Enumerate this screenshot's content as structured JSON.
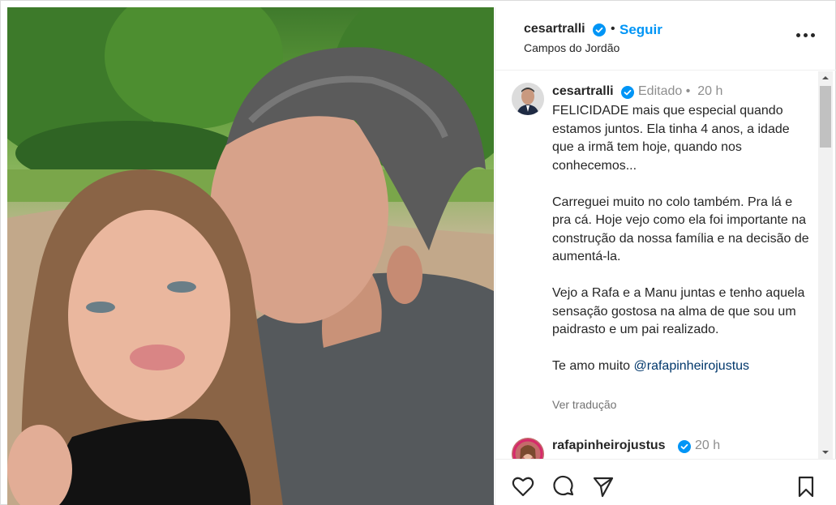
{
  "post": {
    "username": "cesartralli",
    "follow_label": "Seguir",
    "separator": "•",
    "location": "Campos do Jordão",
    "more_icon": "more-options-icon"
  },
  "caption": {
    "username": "cesartralli",
    "edited": "Editado",
    "time": "20 h",
    "paragraphs": [
      "FELICIDADE mais que especial quando estamos juntos. Ela tinha 4 anos, a idade que a irmã tem hoje, quando nos conhecemos...",
      "Carreguei muito no colo também. Pra lá e pra cá. Hoje vejo como ela foi importante na construção da nossa família e na decisão de aumentá-la.",
      "Vejo a Rafa e a Manu juntas e tenho aquela sensação gostosa na alma de que sou um paidrasto e um pai realizado."
    ],
    "closing_text": "Te amo muito",
    "mention": "@rafapinheirojustus",
    "translate_label": "Ver tradução"
  },
  "comment": {
    "username": "rafapinheirojustus",
    "time": "20 h"
  },
  "actions": {
    "icons": [
      "heart-icon",
      "comment-icon",
      "share-icon",
      "bookmark-icon"
    ]
  },
  "colors": {
    "accent": "#0095f6",
    "verified": "#0095f6",
    "text": "#262626",
    "muted": "#8e8e8e",
    "mention": "#00376b"
  }
}
